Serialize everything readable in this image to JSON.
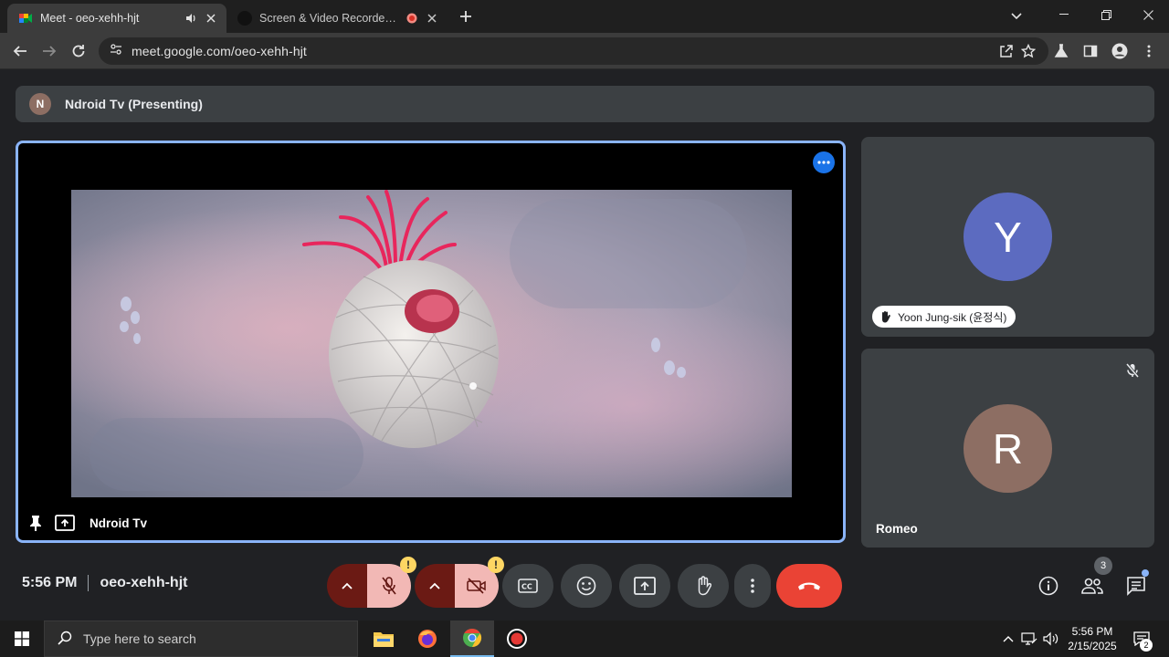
{
  "browser": {
    "tabs": [
      {
        "title": "Meet - oeo-xehh-hjt",
        "active": true
      },
      {
        "title": "Screen & Video Recorder | F",
        "active": false
      }
    ],
    "url": "meet.google.com/oeo-xehh-hjt"
  },
  "meet": {
    "presenting_banner": {
      "avatar_letter": "N",
      "text": "Ndroid Tv (Presenting)"
    },
    "main_tile": {
      "name": "Ndroid Tv"
    },
    "participants": [
      {
        "avatar_letter": "Y",
        "name": "Yoon Jung-sik (윤정식)",
        "hand_raised": true,
        "avatar_color": "#5c6bc0"
      },
      {
        "avatar_letter": "R",
        "name": "Romeo",
        "muted": true,
        "avatar_color": "#8d6e63"
      }
    ],
    "controls": {
      "time": "5:56 PM",
      "meeting_code": "oeo-xehh-hjt",
      "mic_warning": "!",
      "cam_warning": "!",
      "people_count": "3"
    },
    "colors": {
      "accent": "#8ab4f8",
      "end_call": "#ea4335",
      "tile_bg": "#3c4043"
    }
  },
  "taskbar": {
    "search_placeholder": "Type here to search",
    "time": "5:56 PM",
    "date": "2/15/2025",
    "notification_count": "2"
  }
}
